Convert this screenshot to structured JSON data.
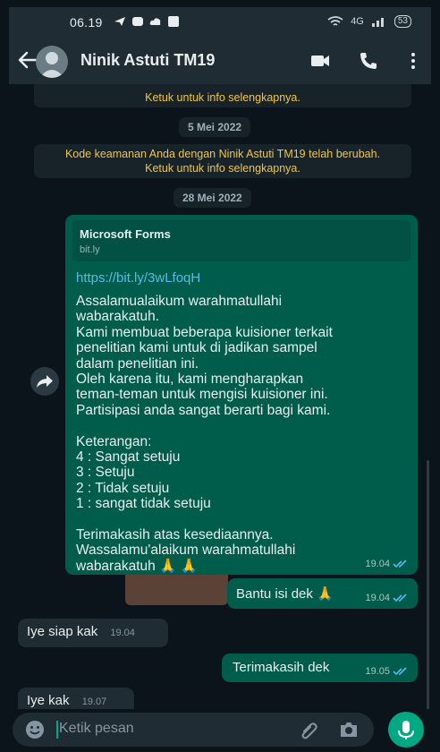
{
  "status_bar": {
    "time": "06.19",
    "network": "4G",
    "battery": "53"
  },
  "header": {
    "contact_name": "Ninik Astuti TM19"
  },
  "system_messages": {
    "top_partial": "Ketuk untuk info selengkapnya.",
    "security_change_line1": "Kode keamanan Anda dengan Ninik Astuti TM19 telah berubah.",
    "security_change_line2": "Ketuk untuk info selengkapnya."
  },
  "dates": {
    "first": "5 Mei 2022",
    "second": "28 Mei 2022"
  },
  "messages": {
    "forwarded": {
      "preview_title": "Microsoft Forms",
      "preview_domain": "bit.ly",
      "link": "https://bit.ly/3wLfoqH",
      "lines": [
        "Assalamualaikum warahmatullahi",
        "wabarakatuh.",
        "Kami membuat beberapa kuisioner terkait",
        "penelitian kami untuk di jadikan sampel",
        "dalam penelitian ini.",
        "Oleh karena itu, kami mengharapkan",
        "teman-teman untuk mengisi kuisioner ini.",
        "Partisipasi anda sangat berarti bagi kami.",
        "",
        "Keterangan:",
        "4 : Sangat setuju",
        "3 : Setuju",
        "2 : Tidak setuju",
        "1 : sangat tidak setuju",
        "",
        "Terimakasih atas kesediaannya.",
        "Wassalamu'alaikum warahmatullahi",
        "wabarakatuh 🙏 🙏"
      ],
      "time": "19.04"
    },
    "out_1": {
      "text": "Bantu isi dek 🙏",
      "time": "19.04"
    },
    "in_1": {
      "text": "Iye siap kak",
      "time": "19.04"
    },
    "out_2": {
      "text": "Terimakasih dek",
      "time": "19.05"
    },
    "in_2": {
      "text": "Iye kak",
      "time": "19.07"
    }
  },
  "composer": {
    "placeholder": "Ketik pesan"
  },
  "colors": {
    "header_bg": "#1f2c34",
    "chat_bg": "#0b141a",
    "outgoing_bubble": "#005c4b",
    "incoming_bubble": "#202c33",
    "accent": "#00a884",
    "system_text": "#f0c64a",
    "read_ticks": "#53bdeb"
  },
  "icons": [
    "back-arrow-icon",
    "avatar-icon",
    "video-call-icon",
    "phone-icon",
    "more-vert-icon",
    "forward-icon",
    "double-check-icon",
    "emoji-icon",
    "attach-icon",
    "camera-icon",
    "mic-icon"
  ]
}
